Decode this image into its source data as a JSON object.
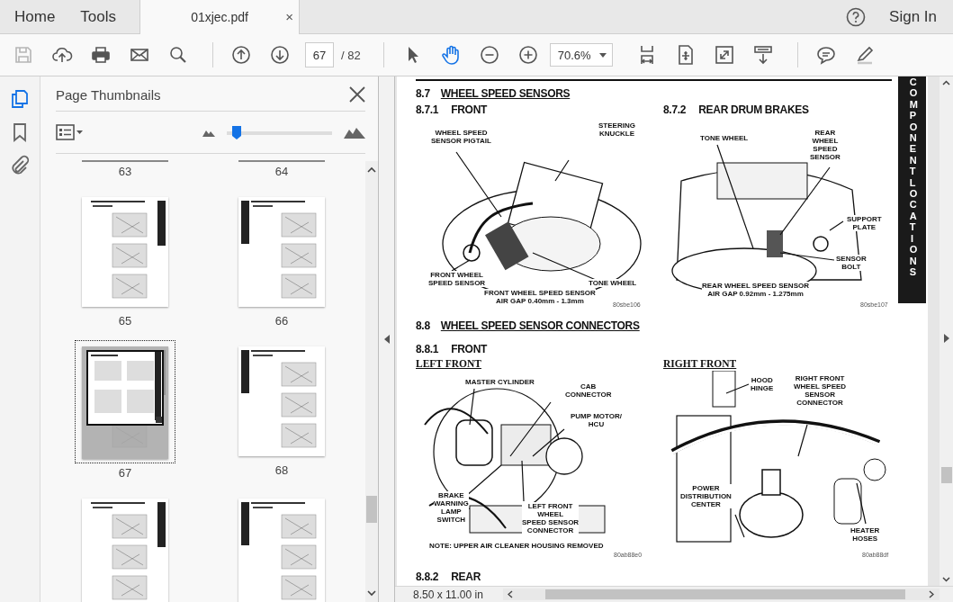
{
  "tabs": [
    {
      "label": "Home",
      "selected": false
    },
    {
      "label": "Tools",
      "selected": false
    },
    {
      "label": "01xjec.pdf",
      "selected": true,
      "close": "×"
    }
  ],
  "sign_in": "Sign In",
  "toolbar": {
    "groups": [
      [
        {
          "kind": "save",
          "disabled": true
        },
        {
          "kind": "upload",
          "disabled": false
        },
        {
          "kind": "print",
          "disabled": false
        },
        {
          "kind": "mail",
          "disabled": false
        },
        {
          "kind": "search",
          "disabled": false
        }
      ],
      [
        {
          "kind": "previous-page",
          "disabled": false
        },
        {
          "kind": "next-page",
          "disabled": false
        },
        {
          "kind": "page-field",
          "value": "67",
          "total": "/ 82"
        }
      ],
      [
        {
          "kind": "select",
          "selected": false
        },
        {
          "kind": "hand",
          "selected": true
        },
        {
          "kind": "zoom-out",
          "disabled": false
        },
        {
          "kind": "zoom-in",
          "disabled": false
        },
        {
          "kind": "zoom-field",
          "value": "70.6%"
        },
        {
          "kind": "fit-width",
          "disabled": false
        },
        {
          "kind": "page-move",
          "disabled": false
        },
        {
          "kind": "fullscreen",
          "disabled": false
        },
        {
          "kind": "scroll-mode",
          "disabled": false
        }
      ],
      [
        {
          "kind": "comment",
          "disabled": false
        },
        {
          "kind": "pen",
          "disabled": false
        }
      ]
    ]
  },
  "sidebar": {
    "tools": [
      {
        "kind": "pages",
        "selected": true
      },
      {
        "kind": "bookmarks",
        "selected": false
      },
      {
        "kind": "attachments",
        "selected": false
      }
    ]
  },
  "thumbnails_panel": {
    "title": "Page Thumbnails",
    "size_slider": {
      "level": 0.06
    },
    "pages": [
      {
        "kind": "cut",
        "label": "63",
        "selected": false
      },
      {
        "kind": "cut",
        "label": "64",
        "selected": false
      },
      {
        "kind": "full",
        "label": "65",
        "selected": false
      },
      {
        "kind": "full",
        "label": "66",
        "selected": false
      },
      {
        "kind": "full",
        "label": "67",
        "selected": true
      },
      {
        "kind": "full",
        "label": "68",
        "selected": false
      },
      {
        "kind": "partial",
        "selected": false
      },
      {
        "kind": "partial",
        "selected": false
      }
    ]
  },
  "document": {
    "side_tab": "COMPONENT LOCATIONS",
    "page_size": "8.50 x 11.00 in",
    "content": [
      {
        "kind": "heading",
        "number": "8.7",
        "title": "WHEEL SPEED SENSORS"
      },
      {
        "kind": "figure-row",
        "columns": [
          {
            "number": "8.7.1",
            "title": "FRONT",
            "figure": {
              "callouts": [
                "WHEEL SPEED\nSENSOR PIGTAIL",
                "STEERING\nKNUCKLE",
                "FRONT WHEEL\nSPEED SENSOR",
                "TONE WHEEL",
                "FRONT WHEEL SPEED SENSOR\nAIR GAP 0.40mm - 1.3mm"
              ],
              "code": "80sbe106"
            }
          },
          {
            "number": "8.7.2",
            "title": "REAR DRUM BRAKES",
            "figure": {
              "callouts": [
                "TONE WHEEL",
                "REAR\nWHEEL\nSPEED\nSENSOR",
                "SUPPORT\nPLATE",
                "SENSOR\nBOLT",
                "REAR WHEEL SPEED SENSOR\nAIR GAP 0.92mm - 1.275mm"
              ],
              "code": "80sbe107"
            }
          }
        ]
      },
      {
        "kind": "heading",
        "number": "8.8",
        "title": "WHEEL SPEED SENSOR CONNECTORS"
      },
      {
        "kind": "subheading",
        "number": "8.8.1",
        "title": "FRONT"
      },
      {
        "kind": "figure-row",
        "columns": [
          {
            "label": "LEFT FRONT",
            "figure": {
              "callouts": [
                "MASTER CYLINDER",
                "CAB\nCONNECTOR",
                "PUMP MOTOR/\nHCU",
                "BRAKE\nWARNING\nLAMP\nSWITCH",
                "LEFT FRONT\nWHEEL\nSPEED SENSOR\nCONNECTOR",
                "NOTE: UPPER AIR CLEANER HOUSING REMOVED"
              ],
              "code": "80ab88e0"
            }
          },
          {
            "label": "RIGHT FRONT",
            "figure": {
              "callouts": [
                "HOOD\nHINGE",
                "RIGHT FRONT\nWHEEL SPEED\nSENSOR\nCONNECTOR",
                "POWER\nDISTRIBUTION\nCENTER",
                "HEATER\nHOSES"
              ],
              "code": "80ab88df"
            }
          }
        ]
      },
      {
        "kind": "subheading",
        "number": "8.8.2",
        "title": "REAR"
      }
    ]
  }
}
